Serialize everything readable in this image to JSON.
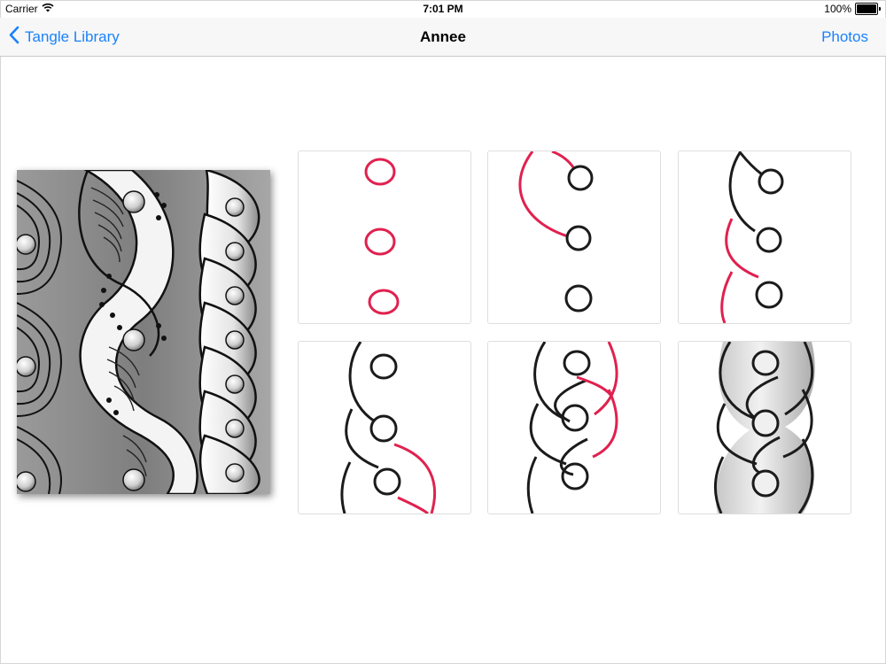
{
  "status_bar": {
    "carrier": "Carrier",
    "time": "7:01 PM",
    "battery": "100%"
  },
  "nav": {
    "back_label": "Tangle Library",
    "title": "Annee",
    "right_label": "Photos"
  },
  "colors": {
    "accent": "#1a82fb",
    "ink": "#1b1b1b",
    "highlight": "#e0214f"
  },
  "icons": {
    "back": "chevron-left-icon",
    "wifi": "wifi-icon",
    "battery": "battery-icon"
  },
  "steps_count": 6
}
